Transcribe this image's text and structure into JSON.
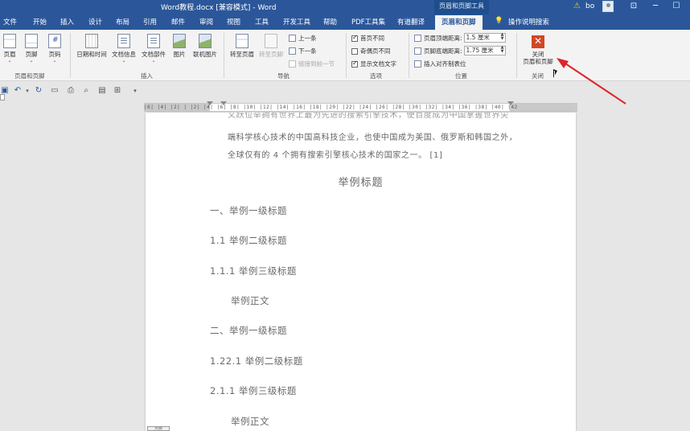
{
  "titlebar": {
    "title": "Word教程.docx [兼容模式] - Word",
    "context_tools": "页眉和页脚工具",
    "user": "bo",
    "warning_icon": "warning-icon",
    "restore_icon": "ribbon-display-icon",
    "minimize": "─",
    "maximize": "☐",
    "close": "✕"
  },
  "tabs": [
    {
      "label": "文件"
    },
    {
      "label": "开始"
    },
    {
      "label": "插入"
    },
    {
      "label": "设计"
    },
    {
      "label": "布局"
    },
    {
      "label": "引用"
    },
    {
      "label": "邮件"
    },
    {
      "label": "审阅"
    },
    {
      "label": "视图"
    },
    {
      "label": "工具"
    },
    {
      "label": "开发工具"
    },
    {
      "label": "帮助"
    },
    {
      "label": "PDF工具集"
    },
    {
      "label": "有道翻译"
    },
    {
      "label": "页眉和页脚"
    }
  ],
  "tell_me": {
    "icon": "lightbulb-icon",
    "label": "操作说明搜索"
  },
  "ribbon": {
    "group_header_footer": {
      "label": "页眉和页脚",
      "header": "页眉",
      "footer": "页脚",
      "page_number": "页码"
    },
    "group_insert": {
      "label": "插入",
      "date_time": "日期和时间",
      "doc_info": "文档信息",
      "doc_parts": "文档部件",
      "picture": "图片",
      "online_picture": "联机图片"
    },
    "group_nav": {
      "label": "导航",
      "goto_header": "转至页眉",
      "goto_footer": "转至页脚",
      "previous": "上一条",
      "next": "下一条",
      "link_previous": "链接到前一节"
    },
    "group_options": {
      "label": "选项",
      "different_first": "首页不同",
      "different_odd_even": "奇偶页不同",
      "show_doc_text": "显示文档文字"
    },
    "group_position": {
      "label": "位置",
      "header_top": "页眉顶端距离:",
      "header_top_value": "1.5 厘米",
      "footer_bottom": "页脚底端距离:",
      "footer_bottom_value": "1.75 厘米",
      "insert_align_tab": "插入对齐制表位"
    },
    "group_close": {
      "label": "关闭",
      "close_button": "关闭\n页眉和页脚"
    }
  },
  "ruler": {
    "ticks": "|6| |4| |2| | |2| |4| |6| |8| |10| |12| |14| |16| |18| |20| |22| |24| |26| |28| |30| |32| |34| |36| |38| |40| |42"
  },
  "document": {
    "cut_line": "又跃位举拥有世界上最为先进的搜索引擎技术，使百度成为中国掌握世界尖",
    "line2": "端科学核心技术的中国高科技企业，也使中国成为美国、俄罗斯和韩国之外，",
    "line3": "全球仅有的 4 个拥有搜索引擎核心技术的国家之一。 [1]",
    "title": "举例标题",
    "h1_a": "一、举例一级标题",
    "h2_a": "1.1 举例二级标题",
    "h3_a": "1.1.1 举例三级标题",
    "body_a": "举例正文",
    "h1_b": "二、举例一级标题",
    "h2_b": "1.22.1 举例二级标题",
    "h3_b": "2.1.1 举例三级标题",
    "body_b": "举例正文",
    "footer_tag": "页脚"
  },
  "colors": {
    "word_blue": "#2b579a",
    "close_red": "#d24726",
    "annotation_arrow": "#d9262b"
  }
}
